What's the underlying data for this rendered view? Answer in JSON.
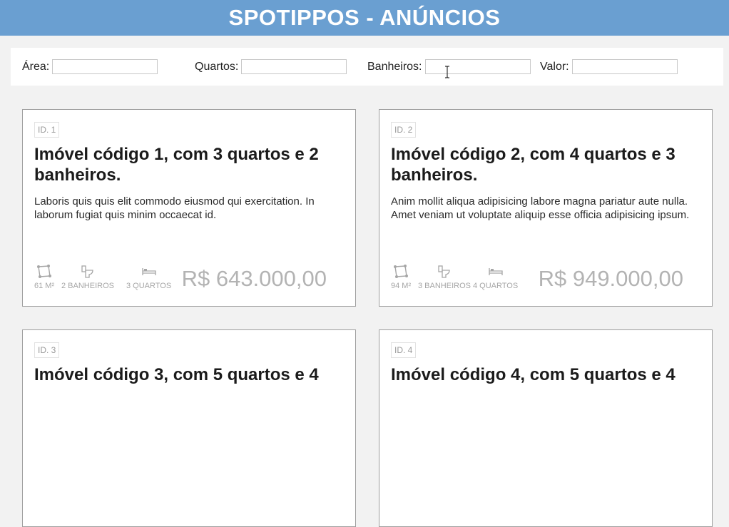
{
  "header": {
    "title": "SPOTIPPOS - ANÚNCIOS"
  },
  "filters": {
    "area_label": "Área:",
    "rooms_label": "Quartos:",
    "baths_label": "Banheiros:",
    "value_label": "Valor:",
    "area_value": "",
    "rooms_value": "",
    "baths_value": "",
    "value_value": ""
  },
  "listings": [
    {
      "id": "ID. 1",
      "title": "Imóvel código 1, com 3 quartos e 2 banheiros.",
      "description": "Laboris quis quis elit commodo eiusmod qui exercitation. In laborum fugiat quis minim occaecat id.",
      "area": "61 M²",
      "baths": "2 BANHEIROS",
      "rooms": "3 QUARTOS",
      "price": "R$ 643.000,00"
    },
    {
      "id": "ID. 2",
      "title": "Imóvel código 2, com 4 quartos e 3 banheiros.",
      "description": "Anim mollit aliqua adipisicing labore magna pariatur aute nulla. Amet veniam ut voluptate aliquip esse officia adipisicing ipsum.",
      "area": "94 M²",
      "baths": "3 BANHEIROS",
      "rooms": "4 QUARTOS",
      "price": "R$ 949.000,00"
    },
    {
      "id": "ID. 3",
      "title": "Imóvel código 3, com 5 quartos e 4"
    },
    {
      "id": "ID. 4",
      "title": "Imóvel código 4, com 5 quartos e 4"
    }
  ],
  "icons": {
    "area": "area-polygon-icon",
    "baths": "toilet-icon",
    "rooms": "bed-icon",
    "cursor": "text-cursor-icon"
  },
  "colors": {
    "header_bg": "#6a9fd1",
    "page_bg": "#f2f2f2",
    "muted_text": "#a6a6a6",
    "price_text": "#b3b3b3"
  }
}
